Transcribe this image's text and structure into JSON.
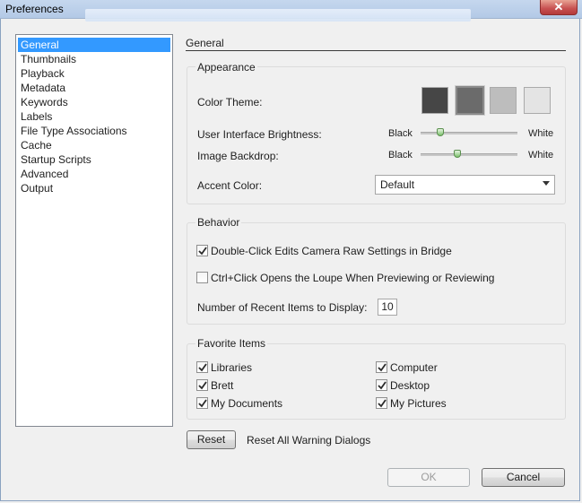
{
  "window": {
    "title": "Preferences",
    "close_glyph": "✕"
  },
  "sidebar": {
    "items": [
      {
        "label": "General",
        "selected": true
      },
      {
        "label": "Thumbnails"
      },
      {
        "label": "Playback"
      },
      {
        "label": "Metadata"
      },
      {
        "label": "Keywords"
      },
      {
        "label": "Labels"
      },
      {
        "label": "File Type Associations"
      },
      {
        "label": "Cache"
      },
      {
        "label": "Startup Scripts"
      },
      {
        "label": "Advanced"
      },
      {
        "label": "Output"
      }
    ]
  },
  "panel": {
    "title": "General"
  },
  "appearance": {
    "label": "Appearance",
    "color_theme_label": "Color Theme:",
    "theme_swatches": [
      {
        "color": "#464646"
      },
      {
        "color": "#6b6b6b",
        "selected": true
      },
      {
        "color": "#bdbdbd"
      },
      {
        "color": "#e4e4e4"
      }
    ],
    "ui_brightness_label": "User Interface Brightness:",
    "backdrop_label": "Image Backdrop:",
    "slider_min_label": "Black",
    "slider_max_label": "White",
    "ui_brightness_value": 0.2,
    "backdrop_value": 0.38,
    "accent_label": "Accent Color:",
    "accent_value": "Default"
  },
  "behavior": {
    "label": "Behavior",
    "double_click_label": "Double-Click Edits Camera Raw Settings in Bridge",
    "double_click_checked": true,
    "ctrl_click_label": "Ctrl+Click Opens the Loupe When Previewing or Reviewing",
    "ctrl_click_checked": false,
    "recent_items_label": "Number of Recent Items to Display:",
    "recent_items_value": "10"
  },
  "favorites": {
    "label": "Favorite Items",
    "items": [
      {
        "label": "Libraries",
        "checked": true
      },
      {
        "label": "Computer",
        "checked": true
      },
      {
        "label": "Brett",
        "checked": true
      },
      {
        "label": "Desktop",
        "checked": true
      },
      {
        "label": "My Documents",
        "checked": true
      },
      {
        "label": "My Pictures",
        "checked": true
      }
    ]
  },
  "reset": {
    "button_label": "Reset",
    "description": "Reset All Warning Dialogs"
  },
  "footer": {
    "ok_label": "OK",
    "cancel_label": "Cancel"
  }
}
